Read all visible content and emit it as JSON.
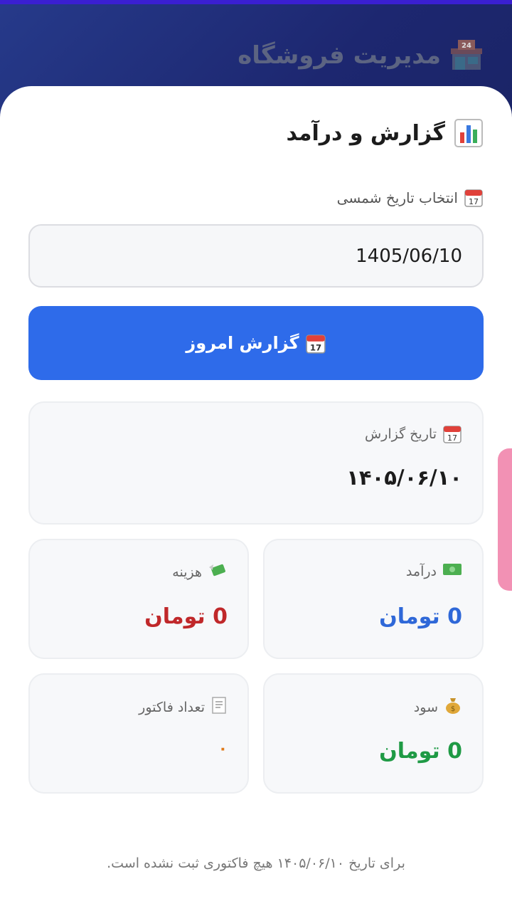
{
  "header": {
    "app_title": "مدیریت فروشگاه",
    "app_icon": "store-24-icon"
  },
  "report": {
    "title": "گزارش و درآمد",
    "title_icon": "bar-chart-icon",
    "date_picker_label": "انتخاب تاریخ شمسی",
    "date_value": "1405/06/10",
    "today_button_label": "گزارش امروز"
  },
  "report_date_card": {
    "label": "تاریخ گزارش",
    "value": "۱۴۰۵/۰۶/۱۰"
  },
  "stats": {
    "income": {
      "label": "درآمد",
      "value": "0 تومان",
      "icon": "money-bill-icon",
      "color": "#2f68d8"
    },
    "expense": {
      "label": "هزینه",
      "value": "0 تومان",
      "icon": "money-wings-icon",
      "color": "#c0282a"
    },
    "profit": {
      "label": "سود",
      "value": "0 تومان",
      "icon": "money-bag-icon",
      "color": "#1f9a45"
    },
    "invoices": {
      "label": "تعداد فاکتور",
      "value": "۰",
      "icon": "receipt-icon",
      "color": "#e07a1a"
    }
  },
  "footer": {
    "message": "برای تاریخ ۱۴۰۵/۰۶/۱۰ هیچ فاکتوری ثبت نشده است."
  },
  "colors": {
    "accent": "#2e6bea",
    "side_tab": "#f291b4"
  }
}
